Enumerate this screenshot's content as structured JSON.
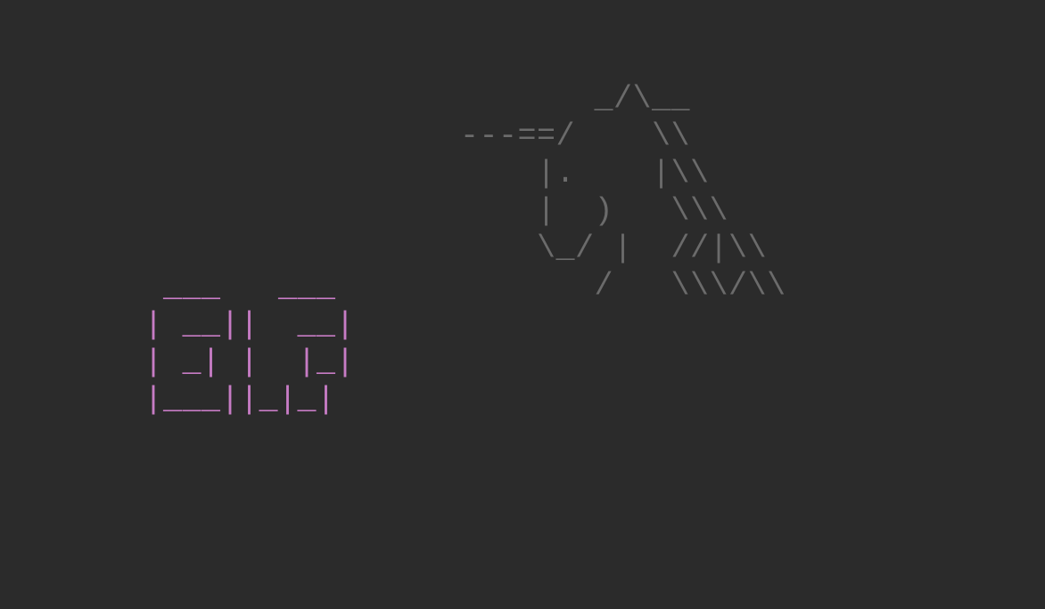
{
  "ascii": {
    "rocket": "           _/\\__\n    ---==/    \\\\\n        |.    |\\\\\n        |  )   \\\\\\\n        \\_/ |  //|\\\\\n           /   \\\\\\/\\\\",
    "digits": "  ___   ___\n | __||  __|\n | _| |  |_|\n |___||_|_|"
  }
}
